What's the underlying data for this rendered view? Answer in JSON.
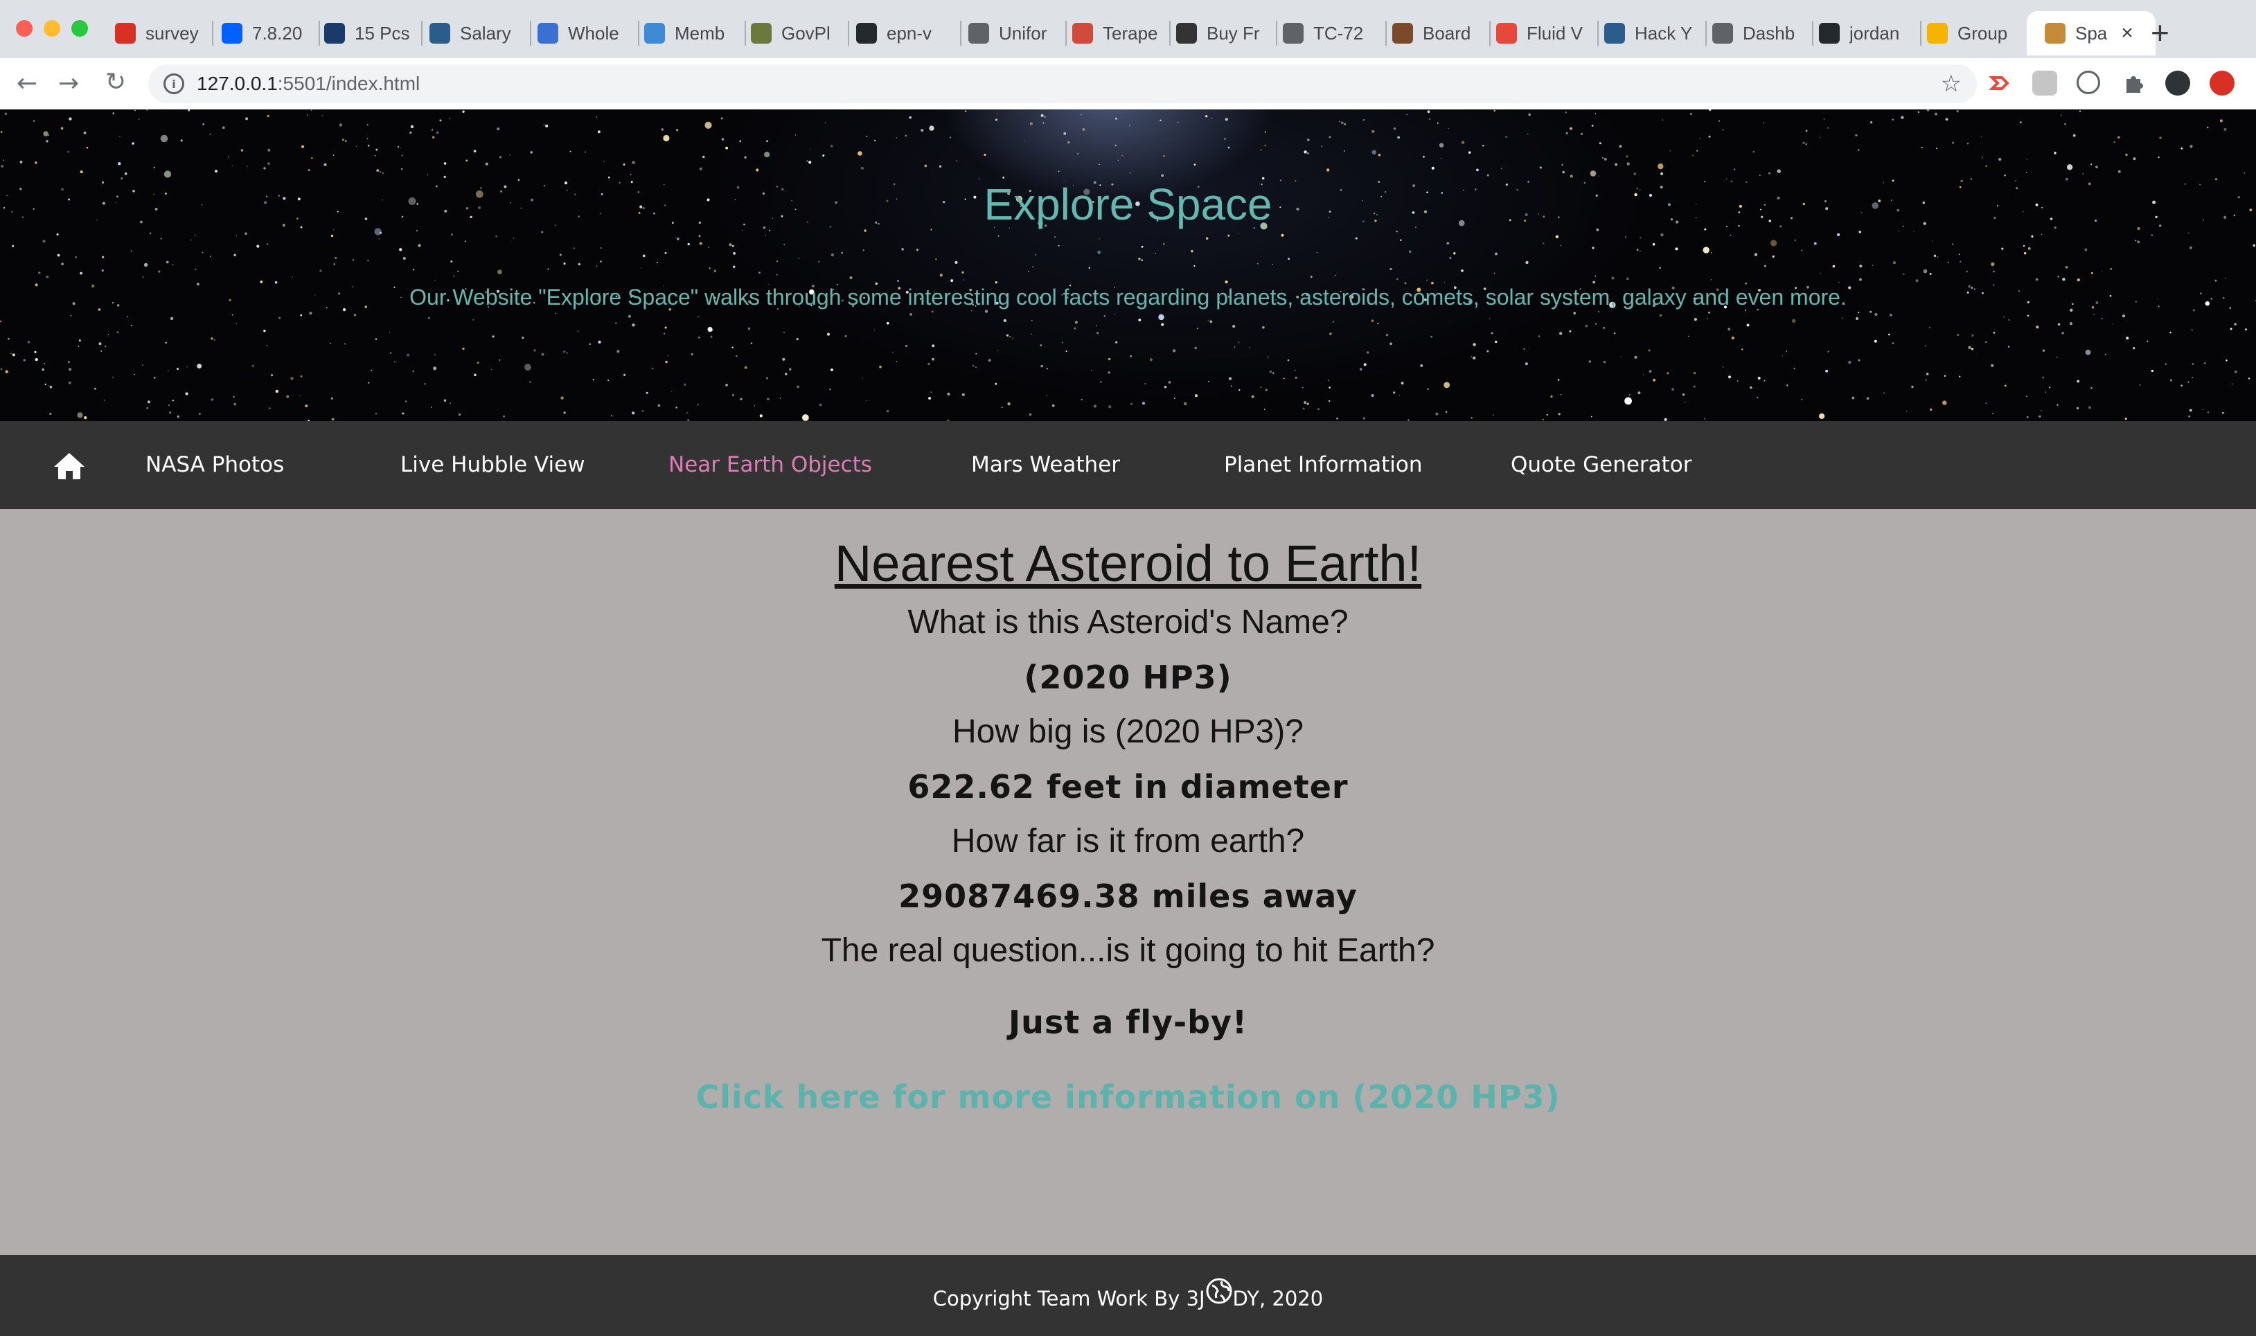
{
  "browser": {
    "tabs": [
      {
        "label": "survey",
        "icon": "gmail-icon",
        "color": "#d93025"
      },
      {
        "label": "7.8.20",
        "icon": "dropbox-icon",
        "color": "#0061fe"
      },
      {
        "label": "15 Pcs",
        "icon": "d-icon",
        "color": "#1a3a6b"
      },
      {
        "label": "Salary",
        "icon": "cs-icon",
        "color": "#2b5d8c"
      },
      {
        "label": "Whole",
        "icon": "target-icon",
        "color": "#3b6fd1"
      },
      {
        "label": "Memb",
        "icon": "doc-icon",
        "color": "#3d8bd4"
      },
      {
        "label": "GovPl",
        "icon": "gp-icon",
        "color": "#6b7a3c"
      },
      {
        "label": "epn-v",
        "icon": "github-icon",
        "color": "#24292e"
      },
      {
        "label": "Unifor",
        "icon": "globe-icon",
        "color": "#5f6368"
      },
      {
        "label": "Terape",
        "icon": "bag-icon",
        "color": "#d14b3c"
      },
      {
        "label": "Buy Fr",
        "icon": "binoculars-icon",
        "color": "#333333"
      },
      {
        "label": "TC-72",
        "icon": "globe-icon",
        "color": "#5f6368"
      },
      {
        "label": "Board",
        "icon": "board-icon",
        "color": "#7a4a2a"
      },
      {
        "label": "Fluid V",
        "icon": "flower-icon",
        "color": "#e8473c"
      },
      {
        "label": "Hack Y",
        "icon": "cs-icon",
        "color": "#2b5d8c"
      },
      {
        "label": "Dashb",
        "icon": "globe-icon",
        "color": "#5f6368"
      },
      {
        "label": "jordan",
        "icon": "github-icon",
        "color": "#24292e"
      },
      {
        "label": "Group",
        "icon": "slides-icon",
        "color": "#f4b400"
      },
      {
        "label": "Spa",
        "icon": "planet-icon",
        "color": "#c58b3a"
      }
    ],
    "url_host": "127.0.0.1",
    "url_rest": ":5501/index.html"
  },
  "header": {
    "title": "Explore Space",
    "subtitle": "Our Website \"Explore Space\" walks through some interesting cool facts regarding planets, asteroids, comets, solar system, galaxy and even more."
  },
  "nav": {
    "home_icon": "home-icon",
    "links": [
      {
        "label": "NASA Photos"
      },
      {
        "label": "Live Hubble View"
      },
      {
        "label": "Near Earth Objects"
      },
      {
        "label": "Mars Weather"
      },
      {
        "label": "Planet Information"
      },
      {
        "label": "Quote Generator"
      }
    ],
    "active_color": "#d97fb4"
  },
  "main": {
    "heading": "Nearest Asteroid to Earth!",
    "q_name": "What is this Asteroid's Name?",
    "a_name": "(2020 HP3)",
    "q_size": "How big is (2020 HP3)?",
    "a_size": "622.62 feet in diameter",
    "q_distance": "How far is it from earth?",
    "a_distance": "29087469.38 miles away",
    "q_hazard": "The real question...is it going to hit Earth?",
    "a_hazard": "Just a fly-by!",
    "more_link": "Click here for more information on (2020 HP3)"
  },
  "footer": {
    "text_before": "Copyright Team Work By 3J",
    "text_after": "DY, 2020"
  },
  "colors": {
    "accent_teal": "#63b8b0",
    "nav_bg": "#333333",
    "content_bg": "#b1adac"
  }
}
